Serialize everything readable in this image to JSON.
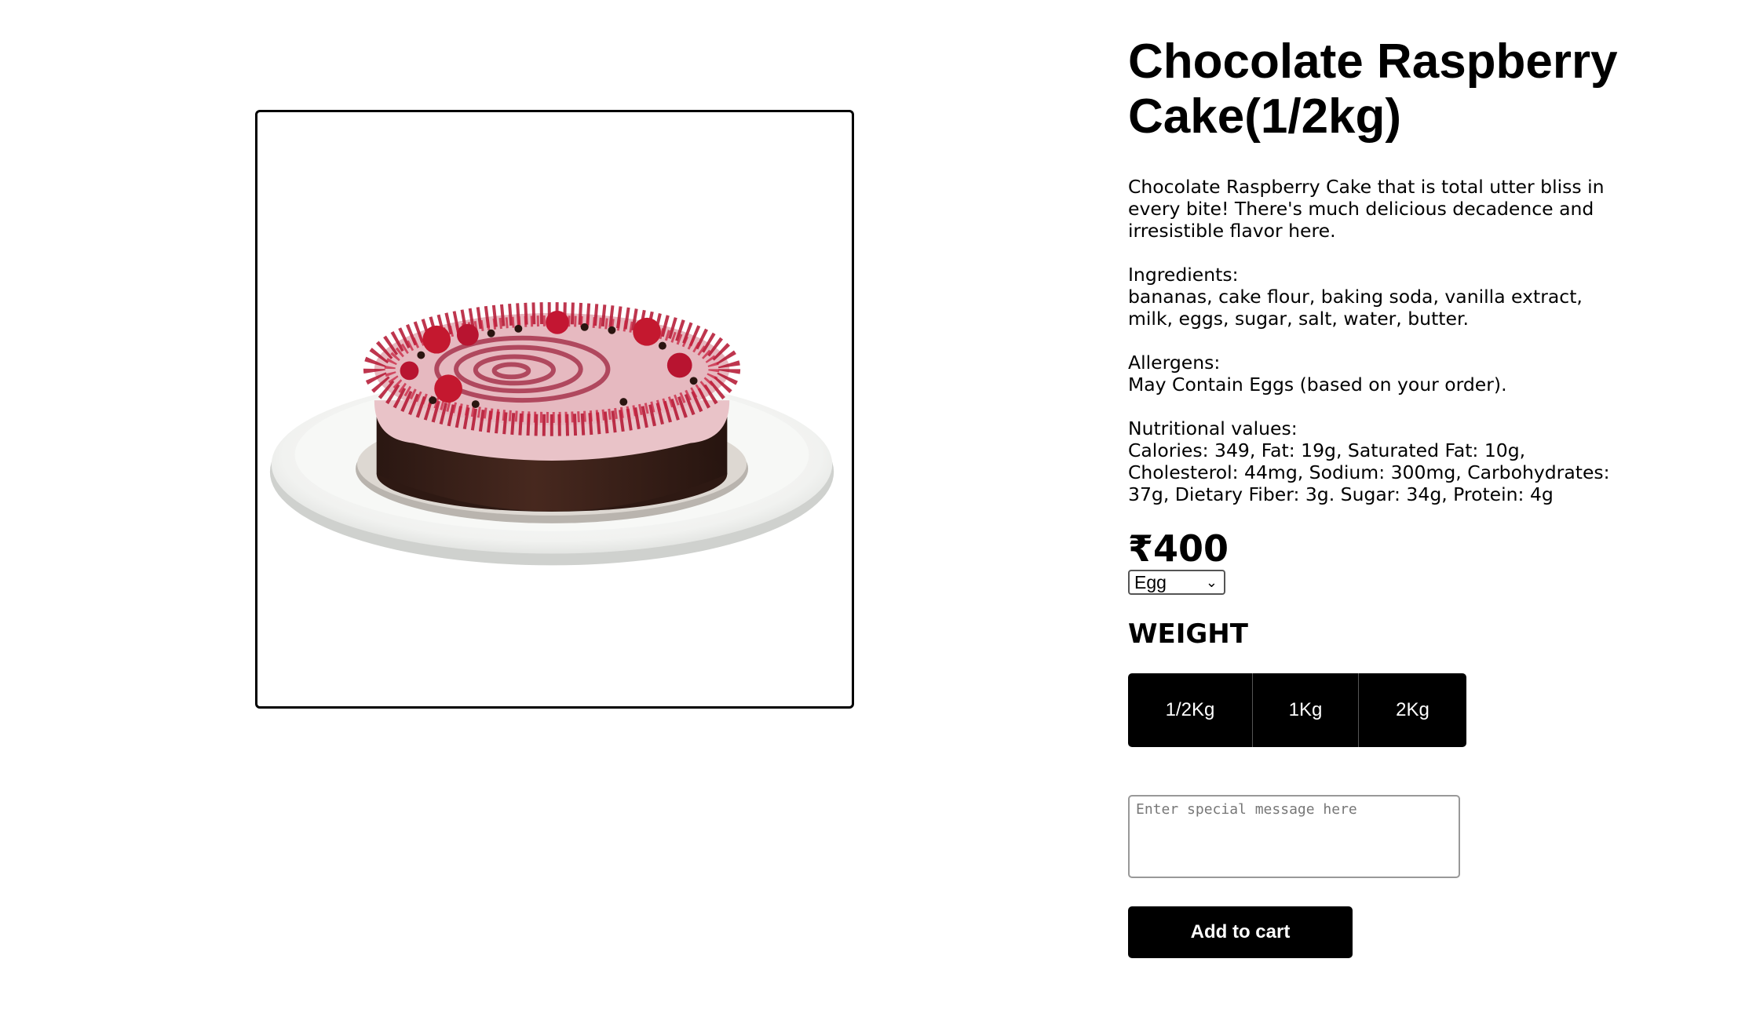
{
  "product": {
    "title": "Chocolate Raspberry Cake(1/2kg)",
    "image_alt": "chocolate raspberry cake on white plate",
    "description": "Chocolate Raspberry Cake that is total utter bliss in every bite! There's much delicious decadence and irresistible flavor here.",
    "ingredients_label": "Ingredients:",
    "ingredients": "bananas, cake flour, baking soda, vanilla extract, milk, eggs, sugar, salt, water, butter.",
    "allergens_label": "Allergens:",
    "allergens": "May Contain Eggs (based on your order).",
    "nutrition_label": "Nutritional values:",
    "nutrition": "Calories: 349, Fat: 19g, Saturated Fat: 10g, Cholesterol: 44mg, Sodium: 300mg, Carbohydrates: 37g, Dietary Fiber: 3g. Sugar: 34g, Protein: 4g",
    "price": "₹400",
    "type_select": {
      "selected": "Egg"
    },
    "weight_heading": "WEIGHT",
    "weights": [
      "1/2Kg",
      "1Kg",
      "2Kg"
    ],
    "message_placeholder": "Enter special message here",
    "add_to_cart_label": "Add to cart"
  }
}
